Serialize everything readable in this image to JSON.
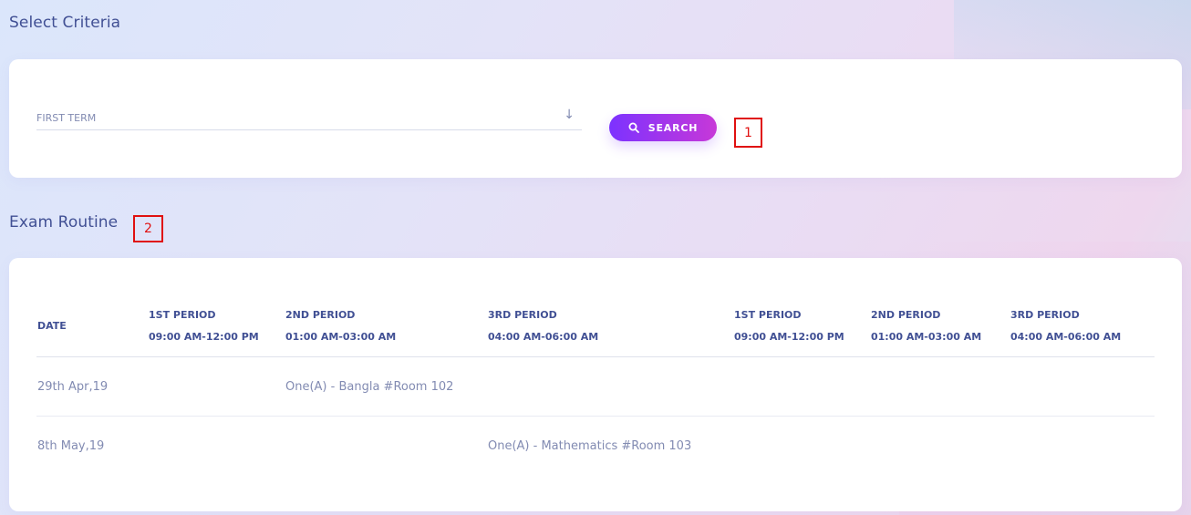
{
  "criteria": {
    "title": "Select Criteria",
    "select_value": "FIRST TERM",
    "search_label": "SEARCH"
  },
  "routine": {
    "title": "Exam Routine",
    "date_header": "DATE",
    "periods": [
      {
        "name": "1ST PERIOD",
        "time": "09:00 AM-12:00 PM"
      },
      {
        "name": "2ND PERIOD",
        "time": "01:00 AM-03:00 AM"
      },
      {
        "name": "3RD PERIOD",
        "time": "04:00 AM-06:00 AM"
      },
      {
        "name": "1ST PERIOD",
        "time": "09:00 AM-12:00 PM"
      },
      {
        "name": "2ND PERIOD",
        "time": "01:00 AM-03:00 AM"
      },
      {
        "name": "3RD PERIOD",
        "time": "04:00 AM-06:00 AM"
      }
    ],
    "rows": [
      {
        "date": "29th Apr,19",
        "cells": [
          "",
          "One(A) - Bangla #Room 102",
          "",
          "",
          "",
          ""
        ]
      },
      {
        "date": "8th May,19",
        "cells": [
          "",
          "",
          "One(A) - Mathematics #Room 103",
          "",
          "",
          ""
        ]
      }
    ]
  },
  "markers": [
    "1",
    "2"
  ],
  "icons": {
    "select_arrow": "arrow-down-icon",
    "search": "search-icon"
  },
  "colors": {
    "heading": "#415094",
    "muted_text": "#828bb2",
    "button_gradient_start": "#7c32ff",
    "button_gradient_end": "#c738d8",
    "marker": "#e01010"
  }
}
